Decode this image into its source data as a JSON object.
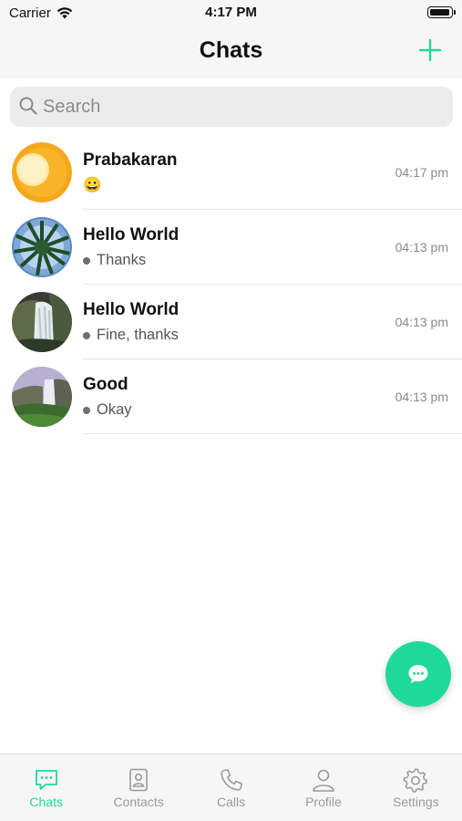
{
  "status_bar": {
    "carrier": "Carrier",
    "time": "4:17 PM"
  },
  "header": {
    "title": "Chats"
  },
  "search": {
    "placeholder": "Search",
    "value": ""
  },
  "chats": [
    {
      "name": "Prabakaran",
      "preview": "😀",
      "time": "04:17 pm",
      "avatar": "sun-avatar",
      "has_dot": false
    },
    {
      "name": "Hello World",
      "preview": "Thanks",
      "time": "04:13 pm",
      "avatar": "palm-tree-avatar",
      "has_dot": true
    },
    {
      "name": "Hello World",
      "preview": "Fine, thanks",
      "time": "04:13 pm",
      "avatar": "waterfall-avatar",
      "has_dot": true
    },
    {
      "name": "Good",
      "preview": "Okay",
      "time": "04:13 pm",
      "avatar": "waterfall-valley-avatar",
      "has_dot": true
    }
  ],
  "fab": {
    "icon": "chat-bubble-icon"
  },
  "tabs": [
    {
      "label": "Chats",
      "icon": "chat-icon",
      "active": true
    },
    {
      "label": "Contacts",
      "icon": "contacts-icon",
      "active": false
    },
    {
      "label": "Calls",
      "icon": "phone-icon",
      "active": false
    },
    {
      "label": "Profile",
      "icon": "person-icon",
      "active": false
    },
    {
      "label": "Settings",
      "icon": "gear-icon",
      "active": false
    }
  ],
  "colors": {
    "accent": "#1fd99b",
    "inactive_tab": "#9a9a9a",
    "bar_background": "#f6f6f6"
  }
}
